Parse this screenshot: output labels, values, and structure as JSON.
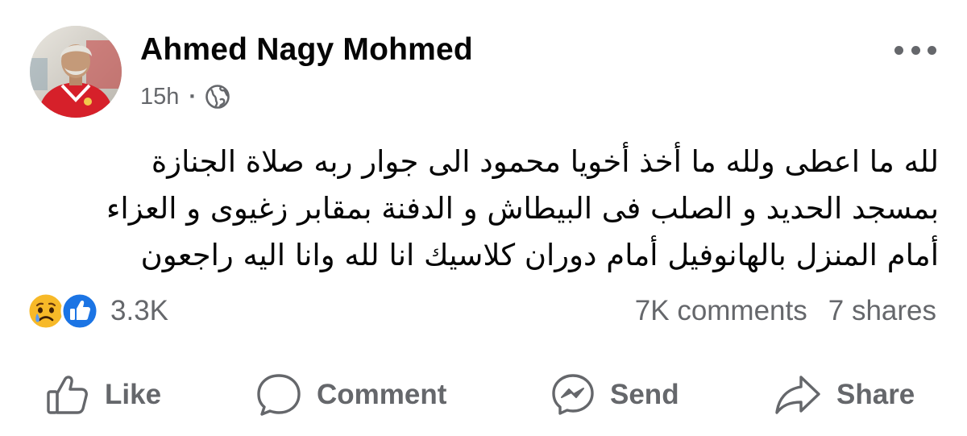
{
  "post": {
    "author": "Ahmed Nagy Mohmed",
    "time": "15h",
    "separator": "·",
    "audience_icon": "globe-icon",
    "text_lines": [
      "لله ما اعطى ولله ما أخذ أخويا محمود الى جوار ربه صلاة الجنازة",
      "بمسجد الحديد و الصلب فى البيطاش و الدفنة بمقابر زغيوى و العزاء",
      "أمام المنزل بالهانوفيل أمام دوران كلاسيك  انا لله وانا اليه راجعون"
    ]
  },
  "stats": {
    "reaction_icons": [
      "sad-reaction-icon",
      "like-reaction-icon"
    ],
    "reactions_count": "3.3K",
    "comments": "7K comments",
    "shares": "7 shares"
  },
  "actions": {
    "like": "Like",
    "comment": "Comment",
    "send": "Send",
    "share": "Share"
  },
  "colors": {
    "secondary_text": "#65676b",
    "like_blue": "#1b74e4",
    "sad_yellow": "#f7b928",
    "avatar_shirt_red": "#d6202a"
  }
}
